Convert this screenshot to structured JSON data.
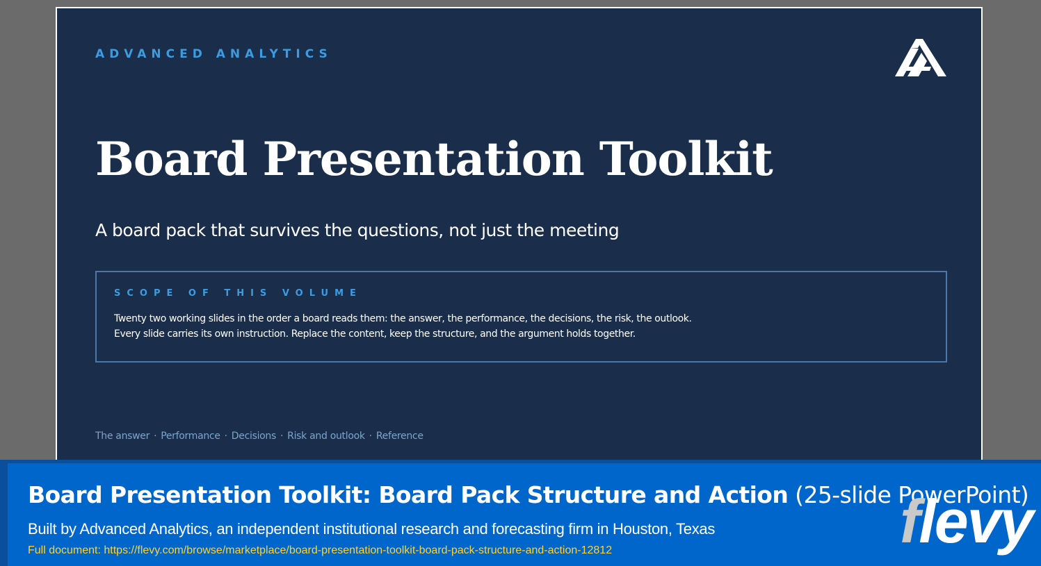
{
  "slide": {
    "kicker": "ADVANCED ANALYTICS",
    "logo_icon": "advanced-analytics-logo",
    "title": "Board Presentation Toolkit",
    "subtitle": "A board pack that survives the questions, not just the meeting",
    "scope": {
      "label": "SCOPE OF THIS VOLUME",
      "lines": [
        "Twenty two working slides in the order a board reads them: the answer, the performance, the decisions, the risk, the outlook.",
        "Every slide carries its own instruction. Replace the content, keep the structure, and the argument holds together."
      ]
    },
    "nav": {
      "items": [
        "The answer",
        "Performance",
        "Decisions",
        "Risk and outlook",
        "Reference"
      ],
      "separator": "·"
    }
  },
  "banner": {
    "title_main": "Board Presentation Toolkit: Board Pack Structure and Action",
    "title_suffix": "(25-slide PowerPoint)",
    "description": "Built by Advanced Analytics, an independent institutional research and forecasting firm in Houston, Texas",
    "link": "Full document: https://flevy.com/browse/marketplace/board-presentation-toolkit-board-pack-structure-and-action-12812",
    "logo_f": "f",
    "logo_rest": "levy"
  },
  "colors": {
    "slide_bg": "#1a2d4a",
    "accent": "#3d9ce0",
    "banner_bg": "#0066cc",
    "link": "#ffd233"
  }
}
